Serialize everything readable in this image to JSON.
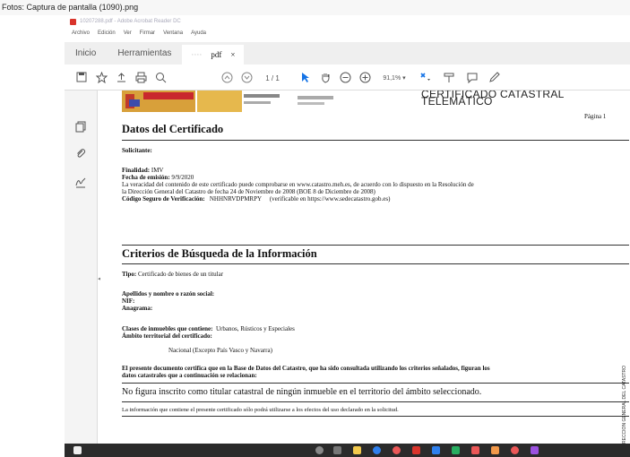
{
  "photo_window_title": "Fotos: Captura de pantalla (1090).png",
  "acrobat": {
    "title": "10207288.pdf - Adobe Acrobat Reader DC",
    "menu": [
      "Archivo",
      "Edición",
      "Ver",
      "Firmar",
      "Ventana",
      "Ayuda"
    ],
    "tabs": {
      "home": "Inicio",
      "tools": "Herramientas",
      "doc": "pdf",
      "doc_close": "×"
    },
    "toolbar": {
      "page": "1 / 1",
      "zoom": "91,1%"
    }
  },
  "document": {
    "header_title": "CERTIFICADO CATASTRAL TELEMÁTICO",
    "page_label": "Página 1",
    "section1_title": "Datos del Certificado",
    "solicitante_label": "Solicitante:",
    "finalidad_label": "Finalidad:",
    "finalidad_value": "IMV",
    "fecha_label": "Fecha de emisión:",
    "fecha_value": "9/9/2020",
    "veracidad_l1": "La veracidad del contenido de este certificado puede comprobarse en www.catastro.meh.es, de acuerdo con lo dispuesto en la Resolución de",
    "veracidad_l2": "la Dirección General del Catastro de fecha 24 de Noviembre de 2008 (BOE 8 de Diciembre de 2008)",
    "csv_label": "Código Seguro de Verificación:",
    "csv_value": "NHHNRVDPMRPY",
    "csv_note": "(verificable en https://www.sedecatastro.gob.es)",
    "section2_title": "Criterios de Búsqueda de la Información",
    "tipo_label": "Tipo:",
    "tipo_value": "Certificado de bienes de un titular",
    "apellidos_label": "Apellidos y nombre o razón social:",
    "nif_label": "NIF:",
    "anagrama_label": "Anagrama:",
    "clases_label": "Clases de inmuebles que contiene:",
    "clases_value": "Urbanos, Rústicos y Especiales",
    "ambito_label": "Ámbito territorial del certificado:",
    "ambito_value": "Nacional (Excepto País Vasco y Navarra)",
    "presente_l1": "El presente documento certifica que en la Base de Datos del Catastro, que ha sido consultada utilizando los criterios señalados, figuran los",
    "presente_l2": "datos catastrales que a continuación se relacionan:",
    "result": "No figura inscrito como titular catastral de ningún inmueble en el territorio del ámbito seleccionado.",
    "footer_note": "La información que contiene el presente certificado sólo podrá utilizarse a los efectos del uso declarado en la solicitud.",
    "side_watermark": "DIRECCIÓN GENERAL DEL CATASTRO"
  },
  "colors": {
    "acrobat_red": "#d9342b",
    "taskbar": "#2b2b2b",
    "cursor_blue": "#1473e6"
  }
}
